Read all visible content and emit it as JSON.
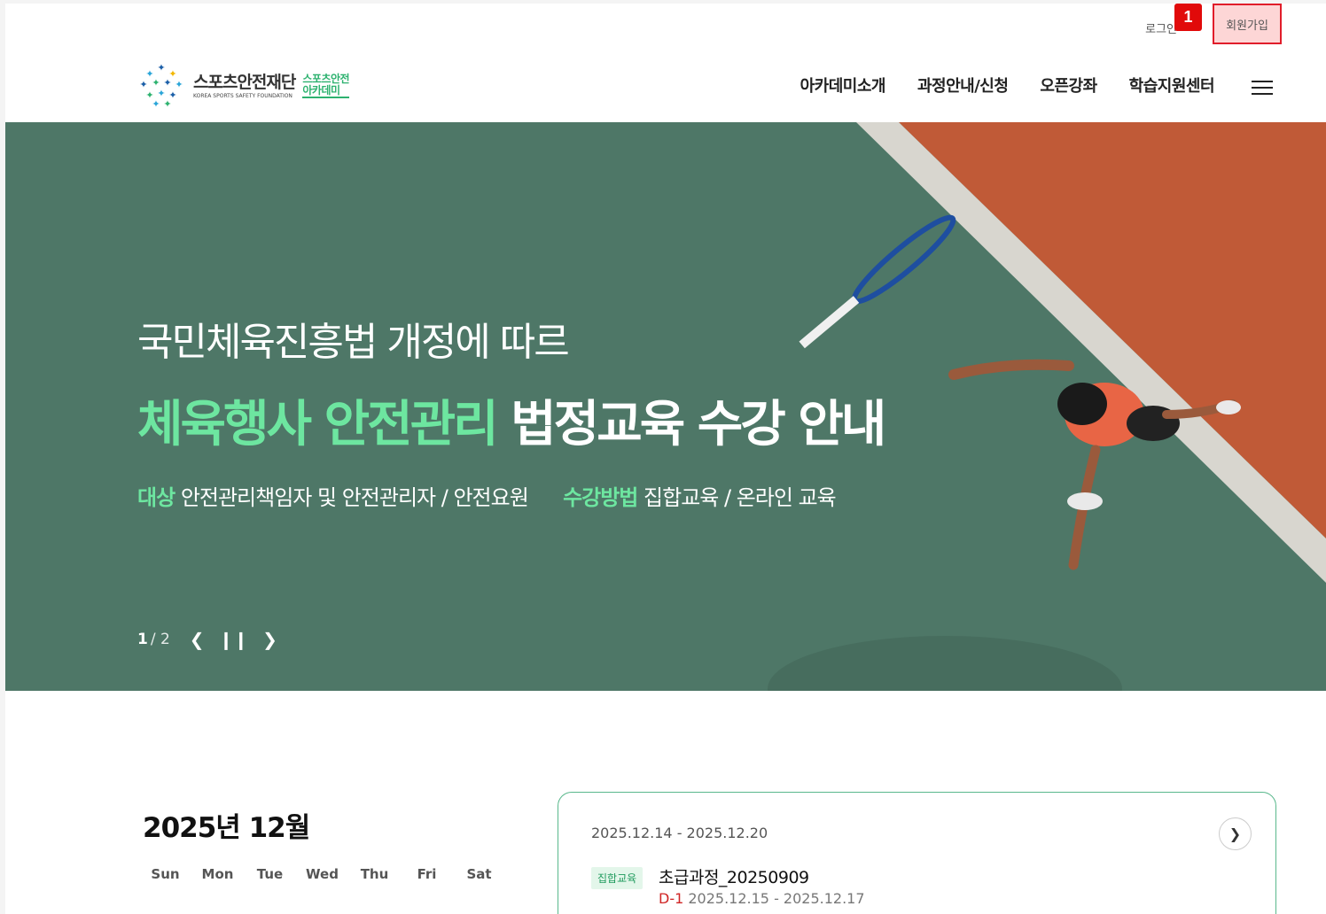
{
  "util": {
    "login_label": "로그인",
    "badge": "1",
    "join_label": "회원가입"
  },
  "logo": {
    "kr": "스포츠안전재단",
    "en": "KOREA SPORTS SAFETY FOUNDATION",
    "sub1": "스포츠안전",
    "sub2": "아카데미"
  },
  "nav": {
    "items": [
      "아카데미소개",
      "과정안내/신청",
      "오픈강좌",
      "학습지원센터"
    ]
  },
  "hero": {
    "line1": "국민체육진흥법 개정에 따르",
    "line2_highlight": "체육행사 안전관리",
    "line2_rest": " 법정교육 수강 안내",
    "target_key": "대상",
    "target_value": "안전관리책임자 및 안전관리자 / 안전요원",
    "method_key": "수강방법",
    "method_value": "집합교육 / 온라인 교육",
    "current_slide": "1",
    "total_slides": "/ 2",
    "colors": {
      "highlight": "#6de6a0",
      "court_green": "#4e7767",
      "court_clay": "#c05a37"
    }
  },
  "calendar": {
    "title": "2025년 12월",
    "weekdays": [
      "Sun",
      "Mon",
      "Tue",
      "Wed",
      "Thu",
      "Fri",
      "Sat"
    ]
  },
  "week_card": {
    "range": "2025.12.14 - 2025.12.20",
    "tag": "집합교육",
    "course": "초급과정_20250909",
    "dday": "D-1",
    "course_dates": "2025.12.15 - 2025.12.17"
  },
  "icons": [
    "logo-mark-icon",
    "hamburger-menu-icon",
    "chevron-left-icon",
    "pause-icon",
    "chevron-right-icon",
    "chevron-right-circle-icon"
  ]
}
